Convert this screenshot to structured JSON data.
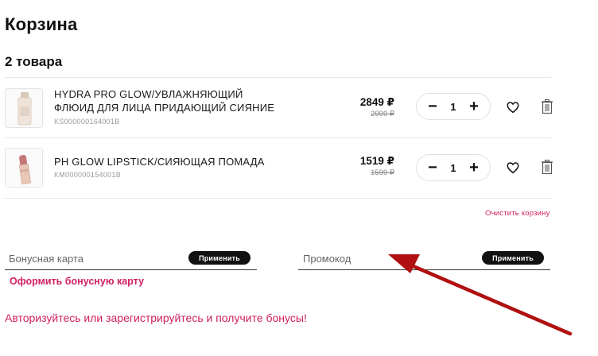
{
  "cart": {
    "title": "Корзина",
    "items_count": "2 товара",
    "clear_label": "Очистить корзину"
  },
  "items": [
    {
      "name_line1": "HYDRA PRO GLOW/УВЛАЖНЯЮЩИЙ",
      "name_line2": "ФЛЮИД ДЛЯ ЛИЦА ПРИДАЮЩИЙ СИЯНИЕ",
      "sku": "KS000000164001B",
      "price": "2849 ₽",
      "old_price": "2999 ₽",
      "qty": "1",
      "minus": "−",
      "plus": "+"
    },
    {
      "name_line1": "PH GLOW LIPSTICK/СИЯЮЩАЯ ПОМАДА",
      "sku": "KM000000154001B",
      "price": "1519 ₽",
      "old_price": "1599 ₽",
      "qty": "1",
      "minus": "−",
      "plus": "+"
    }
  ],
  "bonus": {
    "placeholder": "Бонусная карта",
    "apply_label": "Применить",
    "register_link": "Оформить бонусную карту"
  },
  "promo": {
    "placeholder": "Промокод",
    "apply_label": "Применить"
  },
  "auth_message": "Авторизуйтесь или зарегистрируйтесь и получите бонусы!",
  "colors": {
    "accent": "#d01f63",
    "annotation_arrow": "#b01010",
    "button_bg": "#111111"
  },
  "icons": [
    "heart-icon",
    "trash-icon",
    "minus-icon",
    "plus-icon",
    "annotation-arrow"
  ]
}
